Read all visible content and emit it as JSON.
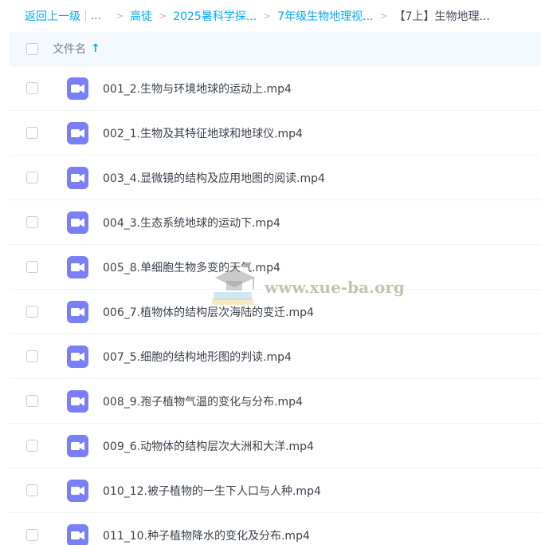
{
  "breadcrumb": {
    "back": "返回上一级",
    "separator": "|",
    "ellipsis": "...",
    "arrow": ">",
    "items": [
      {
        "label": "高徒"
      },
      {
        "label": "2025暑科学探..."
      },
      {
        "label": "7年级生物地理视..."
      }
    ],
    "current": "【7上】生物地理..."
  },
  "table": {
    "header_label": "文件名",
    "sort_arrow": "↑"
  },
  "files": [
    {
      "name": "001_2.生物与环境地球的运动上.mp4"
    },
    {
      "name": "002_1.生物及其特征地球和地球仪.mp4"
    },
    {
      "name": "003_4.显微镜的结构及应用地图的阅读.mp4"
    },
    {
      "name": "004_3.生态系统地球的运动下.mp4"
    },
    {
      "name": "005_8.单细胞生物多变的天气.mp4"
    },
    {
      "name": "006_7.植物体的结构层次海陆的变迁.mp4"
    },
    {
      "name": "007_5.细胞的结构地形图的判读.mp4"
    },
    {
      "name": "008_9.孢子植物气温的变化与分布.mp4"
    },
    {
      "name": "009_6.动物体的结构层次大洲和大洋.mp4"
    },
    {
      "name": "010_12.被子植物的一生下人口与人种.mp4"
    },
    {
      "name": "011_10.种子植物降水的变化及分布.mp4"
    }
  ],
  "icons": {
    "file": "video-file-icon",
    "file_color": "#7b7ff5"
  },
  "watermark": {
    "text": "www.xue-ba.org"
  }
}
